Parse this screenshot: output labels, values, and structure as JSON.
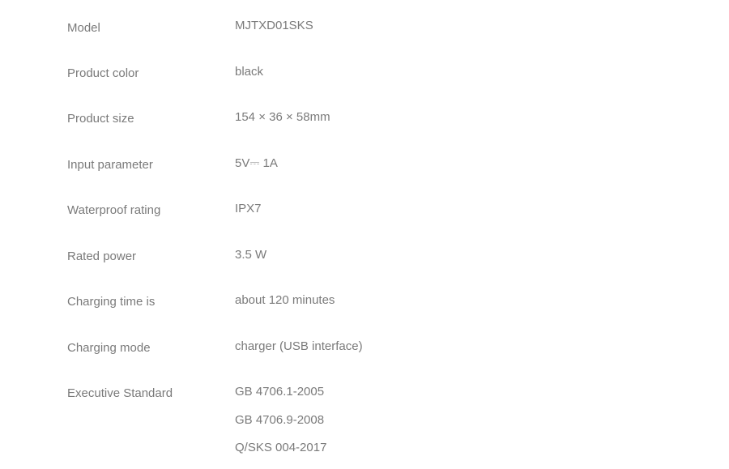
{
  "specs": [
    {
      "label": "Model",
      "value": "MJTXD01SKS"
    },
    {
      "label": "Product color",
      "value": "black"
    },
    {
      "label": "Product size",
      "value": "154 × 36 × 58mm"
    },
    {
      "label": "Input parameter",
      "value": "5V⎓ 1A"
    },
    {
      "label": "Waterproof rating",
      "value": "IPX7"
    },
    {
      "label": "Rated power",
      "value": "3.5 W"
    },
    {
      "label": "Charging time is",
      "value": "about 120 minutes"
    },
    {
      "label": "Charging mode",
      "value": "charger (USB interface)"
    }
  ],
  "standard": {
    "label": "Executive Standard",
    "values": [
      "GB 4706.1-2005",
      "GB 4706.9-2008",
      "Q/SKS 004-2017"
    ]
  }
}
